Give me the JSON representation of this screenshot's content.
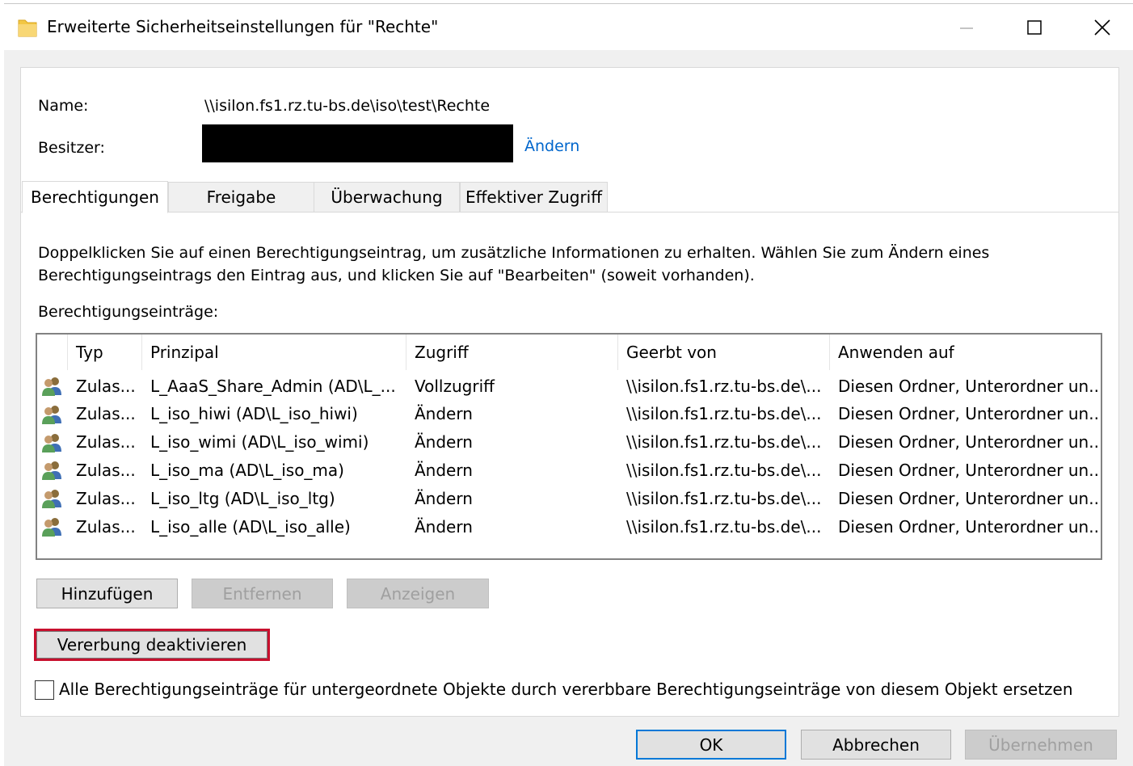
{
  "window": {
    "title": "Erweiterte Sicherheitseinstellungen für \"Rechte\""
  },
  "info": {
    "name_label": "Name:",
    "name_value": "\\\\isilon.fs1.rz.tu-bs.de\\iso\\test\\Rechte",
    "owner_label": "Besitzer:",
    "owner_change_link": "Ändern"
  },
  "tabs": [
    {
      "label": "Berechtigungen",
      "active": true
    },
    {
      "label": "Freigabe",
      "active": false
    },
    {
      "label": "Überwachung",
      "active": false
    },
    {
      "label": "Effektiver Zugriff",
      "active": false
    }
  ],
  "description": {
    "line1": "Doppelklicken Sie auf einen Berechtigungseintrag, um zusätzliche Informationen zu erhalten. Wählen Sie zum Ändern eines",
    "line2": "Berechtigungseintrags den Eintrag aus, und klicken Sie auf \"Bearbeiten\" (soweit vorhanden)."
  },
  "entries_label": "Berechtigungseinträge:",
  "table": {
    "columns": [
      "Typ",
      "Prinzipal",
      "Zugriff",
      "Geerbt von",
      "Anwenden auf"
    ],
    "row_icon": "users-group-icon",
    "rows": [
      {
        "typ": "Zulas...",
        "prinzipal": "L_AaaS_Share_Admin (AD\\L_...",
        "zugriff": "Vollzugriff",
        "geerbt": "\\\\isilon.fs1.rz.tu-bs.de\\...",
        "anwenden": "Diesen Ordner, Unterordner un..."
      },
      {
        "typ": "Zulas...",
        "prinzipal": "L_iso_hiwi (AD\\L_iso_hiwi)",
        "zugriff": "Ändern",
        "geerbt": "\\\\isilon.fs1.rz.tu-bs.de\\...",
        "anwenden": "Diesen Ordner, Unterordner un..."
      },
      {
        "typ": "Zulas...",
        "prinzipal": "L_iso_wimi (AD\\L_iso_wimi)",
        "zugriff": "Ändern",
        "geerbt": "\\\\isilon.fs1.rz.tu-bs.de\\...",
        "anwenden": "Diesen Ordner, Unterordner un..."
      },
      {
        "typ": "Zulas...",
        "prinzipal": "L_iso_ma (AD\\L_iso_ma)",
        "zugriff": "Ändern",
        "geerbt": "\\\\isilon.fs1.rz.tu-bs.de\\...",
        "anwenden": "Diesen Ordner, Unterordner un..."
      },
      {
        "typ": "Zulas...",
        "prinzipal": "L_iso_ltg (AD\\L_iso_ltg)",
        "zugriff": "Ändern",
        "geerbt": "\\\\isilon.fs1.rz.tu-bs.de\\...",
        "anwenden": "Diesen Ordner, Unterordner un..."
      },
      {
        "typ": "Zulas...",
        "prinzipal": "L_iso_alle (AD\\L_iso_alle)",
        "zugriff": "Ändern",
        "geerbt": "\\\\isilon.fs1.rz.tu-bs.de\\...",
        "anwenden": "Diesen Ordner, Unterordner un..."
      }
    ]
  },
  "buttons": {
    "add": "Hinzufügen",
    "remove": "Entfernen",
    "view": "Anzeigen",
    "disable_inheritance": "Vererbung deaktivieren",
    "ok": "OK",
    "cancel": "Abbrechen",
    "apply": "Übernehmen"
  },
  "replace_checkbox": {
    "label": "Alle Berechtigungseinträge für untergeordnete Objekte durch vererbbare Berechtigungseinträge von diesem Objekt ersetzen",
    "checked": false
  },
  "colors": {
    "accent": "#0078d7",
    "link": "#0066cc",
    "highlight": "#c8102e"
  }
}
